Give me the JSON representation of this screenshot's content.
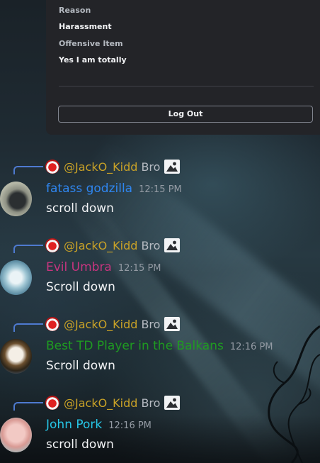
{
  "report_panel": {
    "reason_label": "Reason",
    "reason_value": "Harassment",
    "item_label": "Offensive Item",
    "item_value": "Yes I am totally",
    "logout_label": "Log Out"
  },
  "messages": [
    {
      "reply": {
        "name": "@JackO_Kidd",
        "text": "Bro",
        "attachment_icon": "image-icon"
      },
      "username": "fatass godzilla",
      "username_color": "#2f86f0",
      "timestamp": "12:15 PM",
      "content": "scroll down"
    },
    {
      "reply": {
        "name": "@JackO_Kidd",
        "text": "Bro",
        "attachment_icon": "image-icon"
      },
      "username": "Evil Umbra",
      "username_color": "#c7357f",
      "timestamp": "12:15 PM",
      "content": "Scroll down"
    },
    {
      "reply": {
        "name": "@JackO_Kidd",
        "text": "Bro",
        "attachment_icon": "image-icon"
      },
      "username": "Best TD Player in the Balkans",
      "username_color": "#1f9b21",
      "timestamp": "12:16 PM",
      "content": "Scroll down"
    },
    {
      "reply": {
        "name": "@JackO_Kidd",
        "text": "Bro",
        "attachment_icon": "image-icon"
      },
      "username": "John Pork",
      "username_color": "#26c6e6",
      "timestamp": "12:16 PM",
      "content": "scroll down"
    }
  ],
  "colors": {
    "reply_mention": "#c9a227",
    "reply_spine": "#4e7ad0",
    "panel_bg": "#232428",
    "timestamp": "#949ba4"
  }
}
